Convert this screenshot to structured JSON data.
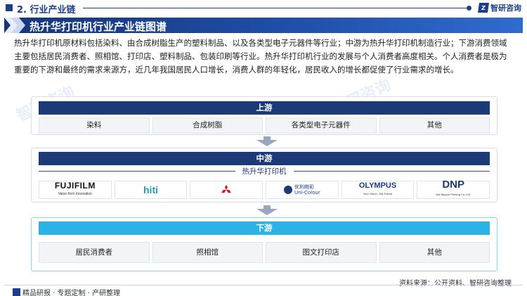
{
  "header": {
    "section_title": "2. 行业产业链",
    "brand_name": "智研咨询",
    "brand_mark": "Z"
  },
  "banner": {
    "title": "热升华打印机行业产业链图谱"
  },
  "intro": {
    "text": "热升华打印机原材料包括染料、由合成树脂生产的塑料制品、以及各类型电子元器件等行业；中游为热升华打印机制造行业；下游消费领域主要包括居民消费者、照相馆、打印店、塑料制品、包装印刷等行业。热升华打印机行业的发展与个人消费者高度相关。个人消费者是极为重要的下游和最终的需求来源方，近几年我国居民人口增长，消费人群的年轻化，居民收入的增长都促使了行业需求的增长。"
  },
  "upstream": {
    "label": "上游",
    "items": [
      "染料",
      "合成树脂",
      "各类型电子元器件",
      "其他"
    ]
  },
  "midstream": {
    "label": "中游",
    "sublabel": "热升华打印机",
    "logos": {
      "fujifilm": {
        "name": "FUJIFILM",
        "tagline": "Value from Innovation"
      },
      "hiti": {
        "name": "hiti"
      },
      "unicolour": {
        "name_cn": "优利绚彩",
        "name_en": "Uni-Colour"
      },
      "olympus": {
        "name": "OLYMPUS",
        "tagline": "Your Vision, Our Future"
      },
      "dnp": {
        "name": "DNP",
        "tagline": "Dai Nippon Printing Co.,Ltd."
      }
    }
  },
  "downstream": {
    "label": "下游",
    "items": [
      "居民消费者",
      "照相馆",
      "图文打印店",
      "其他"
    ]
  },
  "footer": {
    "left_text": "精品研报 · 专题定制 · 产研整理",
    "source": "资料来源：公开资料、智研咨询整理"
  },
  "watermark": {
    "text": "智研咨询"
  },
  "colors": {
    "navy": "#1c3a78",
    "sky": "#2bb2e6",
    "brand": "#1c3f8c"
  }
}
